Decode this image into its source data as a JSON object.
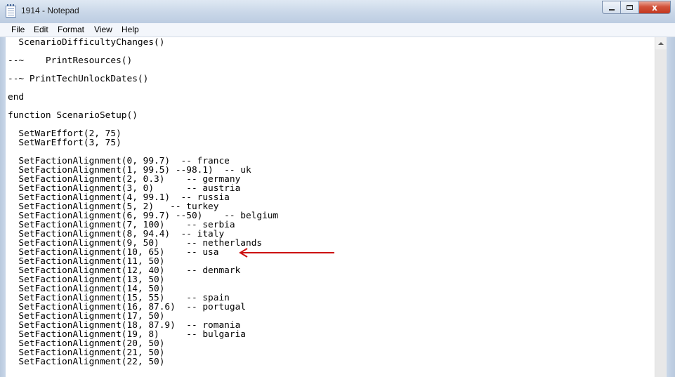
{
  "window": {
    "title": "1914 - Notepad",
    "buttons": {
      "minimize": "minimize",
      "maximize": "maximize",
      "close": "x"
    }
  },
  "menu": [
    "File",
    "Edit",
    "Format",
    "View",
    "Help"
  ],
  "editor": {
    "lines": [
      "  ScenarioDifficultyChanges()",
      "",
      "--~    PrintResources()",
      "",
      "--~ PrintTechUnlockDates()",
      "",
      "end",
      "",
      "function ScenarioSetup()",
      "",
      "  SetWarEffort(2, 75)",
      "  SetWarEffort(3, 75)",
      "",
      "  SetFactionAlignment(0, 99.7)  -- france",
      "  SetFactionAlignment(1, 99.5) --98.1)  -- uk",
      "  SetFactionAlignment(2, 0.3)    -- germany",
      "  SetFactionAlignment(3, 0)      -- austria",
      "  SetFactionAlignment(4, 99.1)  -- russia",
      "  SetFactionAlignment(5, 2)   -- turkey",
      "  SetFactionAlignment(6, 99.7) --50)    -- belgium",
      "  SetFactionAlignment(7, 100)    -- serbia",
      "  SetFactionAlignment(8, 94.4)  -- italy",
      "  SetFactionAlignment(9, 50)     -- netherlands",
      "  SetFactionAlignment(10, 65)    -- usa",
      "  SetFactionAlignment(11, 50)",
      "  SetFactionAlignment(12, 40)    -- denmark",
      "  SetFactionAlignment(13, 50)",
      "  SetFactionAlignment(14, 50)",
      "  SetFactionAlignment(15, 55)    -- spain",
      "  SetFactionAlignment(16, 87.6)  -- portugal",
      "  SetFactionAlignment(17, 50)",
      "  SetFactionAlignment(18, 87.9)  -- romania",
      "  SetFactionAlignment(19, 8)     -- bulgaria",
      "  SetFactionAlignment(20, 50)",
      "  SetFactionAlignment(21, 50)",
      "  SetFactionAlignment(22, 50)"
    ]
  },
  "annotation": {
    "icon": "red-arrow-left",
    "color": "#cc1111"
  },
  "colors": {
    "titlebar": "#c9d7e8",
    "close": "#c3381f"
  }
}
